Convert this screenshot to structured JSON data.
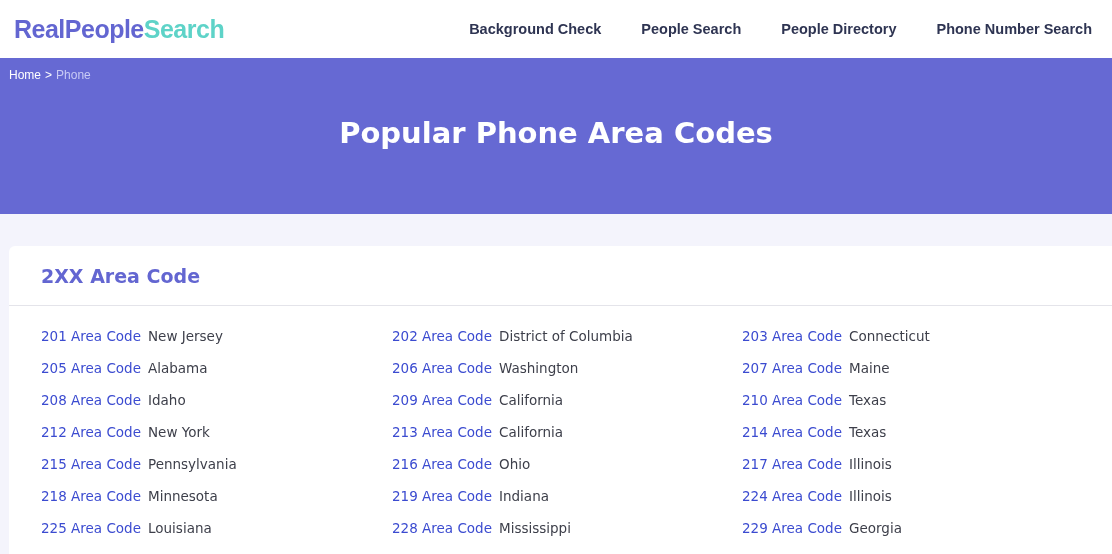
{
  "logo": {
    "part_1": "RealPeople",
    "part_2": "Search"
  },
  "nav": [
    "Background Check",
    "People Search",
    "People Directory",
    "Phone Number Search"
  ],
  "breadcrumb": {
    "separator": ">",
    "items": [
      {
        "label": "Home",
        "selected": false
      },
      {
        "label": "Phone",
        "selected": true
      }
    ]
  },
  "title": "Popular Phone Area Codes",
  "section": {
    "heading": "2XX Area Code",
    "rows": [
      [
        {
          "code": "201 Area Code",
          "state": "New Jersey"
        },
        {
          "code": "202 Area Code",
          "state": "District of Columbia"
        },
        {
          "code": "203 Area Code",
          "state": "Connecticut"
        }
      ],
      [
        {
          "code": "205 Area Code",
          "state": "Alabama"
        },
        {
          "code": "206 Area Code",
          "state": "Washington"
        },
        {
          "code": "207 Area Code",
          "state": "Maine"
        }
      ],
      [
        {
          "code": "208 Area Code",
          "state": "Idaho"
        },
        {
          "code": "209 Area Code",
          "state": "California"
        },
        {
          "code": "210 Area Code",
          "state": "Texas"
        }
      ],
      [
        {
          "code": "212 Area Code",
          "state": "New York"
        },
        {
          "code": "213 Area Code",
          "state": "California"
        },
        {
          "code": "214 Area Code",
          "state": "Texas"
        }
      ],
      [
        {
          "code": "215 Area Code",
          "state": "Pennsylvania"
        },
        {
          "code": "216 Area Code",
          "state": "Ohio"
        },
        {
          "code": "217 Area Code",
          "state": "Illinois"
        }
      ],
      [
        {
          "code": "218 Area Code",
          "state": "Minnesota"
        },
        {
          "code": "219 Area Code",
          "state": "Indiana"
        },
        {
          "code": "224 Area Code",
          "state": "Illinois"
        }
      ],
      [
        {
          "code": "225 Area Code",
          "state": "Louisiana"
        },
        {
          "code": "228 Area Code",
          "state": "Mississippi"
        },
        {
          "code": "229 Area Code",
          "state": "Georgia"
        }
      ]
    ]
  }
}
